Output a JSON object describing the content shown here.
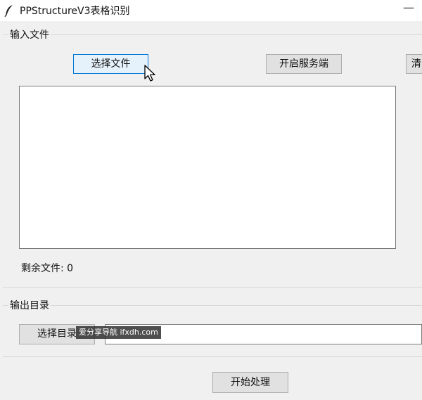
{
  "window": {
    "title": "PPStructureV3表格识别",
    "minimize_glyph": "—"
  },
  "input_section": {
    "label": "输入文件",
    "select_button": "选择文件",
    "service_button": "开启服务端",
    "clear_button": "清",
    "remaining_label": "剩余文件: 0"
  },
  "output_section": {
    "label": "输出目录",
    "select_button": "选择目录",
    "path_value": ""
  },
  "start_button": "开始处理",
  "watermark": "爱分享导航 ifxdh.com",
  "icons": {
    "app": "feather-icon",
    "cursor": "mouse-pointer-icon"
  },
  "colors": {
    "focus_border": "#0078d7",
    "button_bg": "#e1e1e1",
    "window_bg": "#f0f0f0"
  }
}
